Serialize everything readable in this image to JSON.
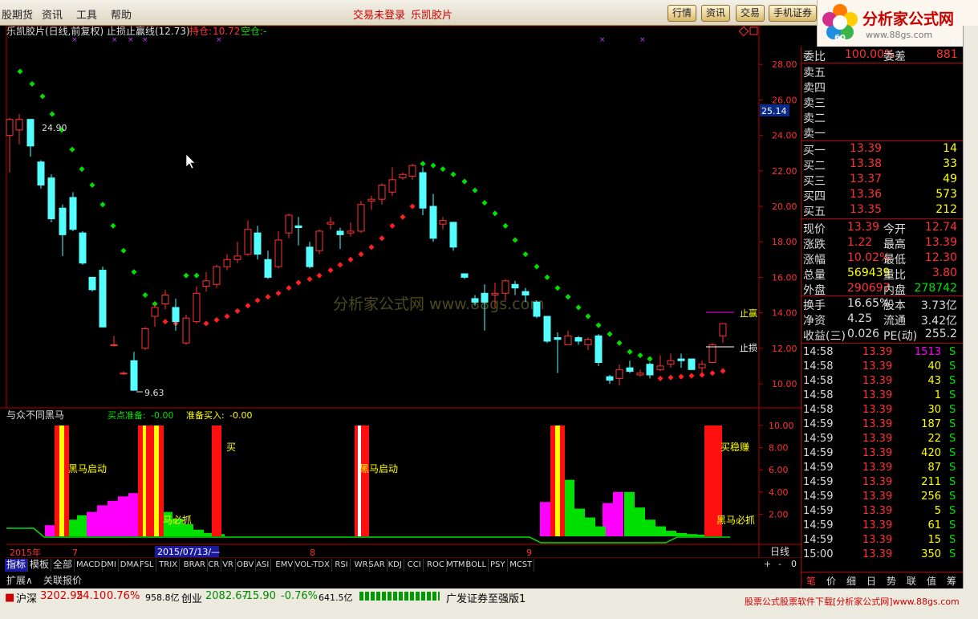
{
  "menu": {
    "items": [
      "股期货",
      "资讯",
      "工具",
      "帮助"
    ],
    "center_links": [
      "交易未登录",
      "乐凯胶片"
    ]
  },
  "top_tabs": [
    "行情",
    "资讯",
    "交易",
    "手机证券"
  ],
  "brand": {
    "name": "分析家公式网",
    "url": "www.88gs.com",
    "badge": "60"
  },
  "chart_header": {
    "title": "乐凯胶片(日线,前复权) 止损止赢线(12.73)",
    "hold_label": "持仓:",
    "hold_value": "10.72",
    "empty_label": "空仓:",
    "empty_value": "-"
  },
  "price_axis": {
    "ticks": [
      "28.00",
      "26.00",
      "24.00",
      "22.00",
      "20.00",
      "18.00",
      "16.00",
      "14.00",
      "12.00",
      "10.00"
    ],
    "marker": "25.14"
  },
  "annotations": {
    "high": "24.90",
    "low": "9.63",
    "stop1": "止赢",
    "stop2": "止损"
  },
  "watermark": "分析家公式网  www.88gs.com",
  "indicator": {
    "title": "与众不同黑马",
    "buy_prep_label": "买点准备:",
    "buy_prep_value": "-0.00",
    "ready_label": "准备买入:",
    "ready_value": "-0.00",
    "labels": {
      "start1": "黑马启动",
      "must": "马必抓",
      "buy": "买",
      "start2": "黑马启动",
      "steady": "买稳赚",
      "must2": "黑马必抓"
    },
    "axis": [
      "10.00",
      "8.00",
      "6.00",
      "4.00",
      "2.00"
    ]
  },
  "date_axis": {
    "year": "2015年",
    "m7": "7",
    "cursor": "2015/07/13/—",
    "m8": "8",
    "m9": "9",
    "period": "日线",
    "zoom": [
      "+",
      "-",
      "0"
    ]
  },
  "tabs": [
    "指标",
    "模板",
    "全部",
    "MACD",
    "DMI",
    "DMA",
    "FSL",
    "TRIX",
    "BRAR",
    "CR",
    "VR",
    "OBV",
    "ASI",
    "EMV",
    "VOL-TDX",
    "RSI",
    "WR",
    "SAR",
    "KDJ",
    "CCI",
    "ROC",
    "MTM",
    "BOLL",
    "PSY",
    "MCST"
  ],
  "tabs2": [
    "扩展∧",
    "关联报价"
  ],
  "quote": {
    "ratio_label": "委比",
    "ratio": "100.00%",
    "diff_label": "委差",
    "diff": "881",
    "sells": [
      "卖五",
      "卖四",
      "卖三",
      "卖二",
      "卖一"
    ],
    "buys": [
      {
        "l": "买一",
        "p": "13.39",
        "v": "14"
      },
      {
        "l": "买二",
        "p": "13.38",
        "v": "33"
      },
      {
        "l": "买三",
        "p": "13.37",
        "v": "49"
      },
      {
        "l": "买四",
        "p": "13.36",
        "v": "573"
      },
      {
        "l": "买五",
        "p": "13.35",
        "v": "212"
      }
    ],
    "stats": [
      {
        "l1": "现价",
        "v1": "13.39",
        "l2": "今开",
        "v2": "12.74"
      },
      {
        "l1": "涨跌",
        "v1": "1.22",
        "l2": "最高",
        "v2": "13.39"
      },
      {
        "l1": "涨幅",
        "v1": "10.02%",
        "l2": "最低",
        "v2": "12.30"
      },
      {
        "l1": "总量",
        "v1": "569439",
        "l2": "量比",
        "v2": "3.80"
      },
      {
        "l1": "外盘",
        "v1": "290697",
        "l2": "内盘",
        "v2": "278742"
      },
      {
        "l1": "换手",
        "v1": "16.65%",
        "l2": "股本",
        "v2": "3.73亿"
      },
      {
        "l1": "净资",
        "v1": "4.25",
        "l2": "流通",
        "v2": "3.42亿"
      },
      {
        "l1": "收益(三)",
        "v1": "0.026",
        "l2": "PE(动)",
        "v2": "255.2"
      }
    ],
    "ticks": [
      {
        "t": "14:58",
        "p": "13.39",
        "v": "1513",
        "s": "S"
      },
      {
        "t": "14:58",
        "p": "13.39",
        "v": "40",
        "s": "S"
      },
      {
        "t": "14:58",
        "p": "13.39",
        "v": "43",
        "s": "S"
      },
      {
        "t": "14:58",
        "p": "13.39",
        "v": "1",
        "s": "S"
      },
      {
        "t": "14:58",
        "p": "13.39",
        "v": "30",
        "s": "S"
      },
      {
        "t": "14:59",
        "p": "13.39",
        "v": "187",
        "s": "S"
      },
      {
        "t": "14:59",
        "p": "13.39",
        "v": "22",
        "s": "S"
      },
      {
        "t": "14:59",
        "p": "13.39",
        "v": "420",
        "s": "S"
      },
      {
        "t": "14:59",
        "p": "13.39",
        "v": "87",
        "s": "S"
      },
      {
        "t": "14:59",
        "p": "13.39",
        "v": "211",
        "s": "S"
      },
      {
        "t": "14:59",
        "p": "13.39",
        "v": "256",
        "s": "S"
      },
      {
        "t": "14:59",
        "p": "13.39",
        "v": "5",
        "s": "S"
      },
      {
        "t": "14:59",
        "p": "13.39",
        "v": "61",
        "s": "S"
      },
      {
        "t": "14:59",
        "p": "13.39",
        "v": "15",
        "s": "S"
      },
      {
        "t": "15:00",
        "p": "13.39",
        "v": "350",
        "s": "S"
      }
    ],
    "bottom_tabs": [
      "笔",
      "价",
      "细",
      "日",
      "势",
      "联",
      "值",
      "筹"
    ]
  },
  "status": {
    "sh_label": "沪深",
    "sh": "3202.95",
    "sh_chg": "24.10",
    "sh_pct": "0.76%",
    "sh_amt": "958.8亿",
    "cy_label": "创业",
    "cy": "2082.67",
    "cy_chg": "-15.90",
    "cy_pct": "-0.76%",
    "cy_amt": "641.5亿",
    "broker": "广发证券至强版1",
    "ad": "股票公式股票软件下载[分析家公式网]www.88gs.com"
  },
  "colors": {
    "up": "#ff3232",
    "down": "#54ffff",
    "sar_up": "#00e000",
    "sar_down": "#ff2020",
    "magenta": "#ff00ff",
    "yellow": "#ffff00"
  }
}
